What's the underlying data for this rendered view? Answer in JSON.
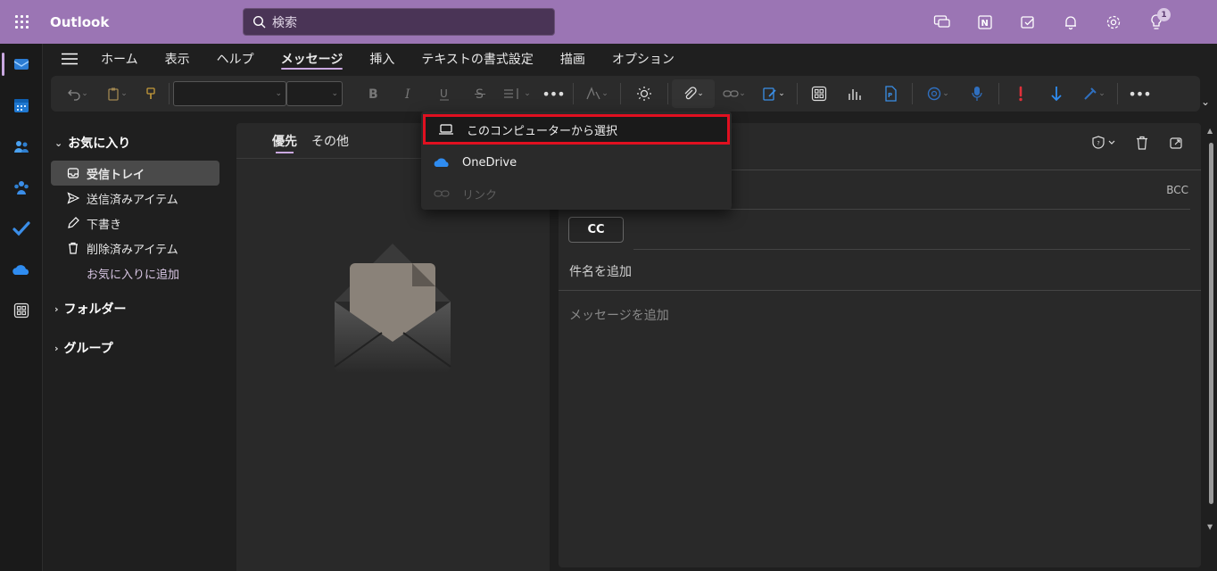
{
  "app": {
    "name": "Outlook"
  },
  "search": {
    "placeholder": "検索"
  },
  "header": {
    "notification_badge": "1"
  },
  "ribbon": {
    "tabs": [
      {
        "label": "ホーム"
      },
      {
        "label": "表示"
      },
      {
        "label": "ヘルプ"
      },
      {
        "label": "メッセージ",
        "active": true
      },
      {
        "label": "挿入"
      },
      {
        "label": "テキストの書式設定"
      },
      {
        "label": "描画"
      },
      {
        "label": "オプション"
      }
    ]
  },
  "folders": {
    "favorites_label": "お気に入り",
    "items": [
      {
        "label": "受信トレイ",
        "icon": "inbox-icon",
        "active": true
      },
      {
        "label": "送信済みアイテム",
        "icon": "send-icon"
      },
      {
        "label": "下書き",
        "icon": "draft-icon"
      },
      {
        "label": "削除済みアイテム",
        "icon": "trash-icon"
      }
    ],
    "add_favorite": "お気に入りに追加",
    "folders_label": "フォルダー",
    "groups_label": "グループ"
  },
  "message_list": {
    "tabs": [
      {
        "label": "優先",
        "active": true
      },
      {
        "label": "その他"
      }
    ]
  },
  "compose": {
    "bcc_label": "BCC",
    "cc_label": "CC",
    "subject_placeholder": "件名を追加",
    "body_placeholder": "メッセージを追加"
  },
  "attach_menu": {
    "items": [
      {
        "label": "このコンピューターから選択",
        "icon": "laptop-icon",
        "highlighted": true
      },
      {
        "label": "OneDrive",
        "icon": "onedrive-icon"
      },
      {
        "label": "リンク",
        "icon": "link-icon",
        "disabled": true
      }
    ]
  },
  "colors": {
    "header": "#9b75b4",
    "accent": "#c9a8e0",
    "highlight_border": "#e01020"
  }
}
